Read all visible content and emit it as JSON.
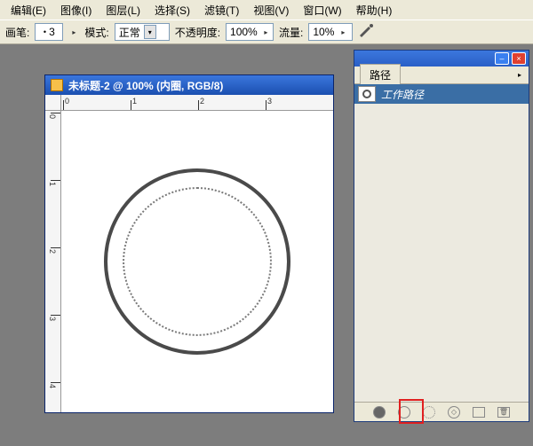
{
  "menu": {
    "edit": "编辑(E)",
    "image": "图像(I)",
    "layer": "图层(L)",
    "select": "选择(S)",
    "filter": "滤镜(T)",
    "view": "视图(V)",
    "window": "窗口(W)",
    "help": "帮助(H)"
  },
  "options": {
    "brush_label": "画笔:",
    "brush_size": "3",
    "mode_label": "模式:",
    "mode_value": "正常",
    "opacity_label": "不透明度:",
    "opacity_value": "100%",
    "flow_label": "流量:",
    "flow_value": "10%"
  },
  "panel": {
    "tab_label": "路径",
    "work_path": "工作路径"
  },
  "document": {
    "title": "未标题-2 @ 100% (内圈, RGB/8)",
    "ruler_h": [
      "0",
      "1",
      "2",
      "3"
    ],
    "ruler_v": [
      "0",
      "1",
      "2",
      "3",
      "4"
    ]
  }
}
